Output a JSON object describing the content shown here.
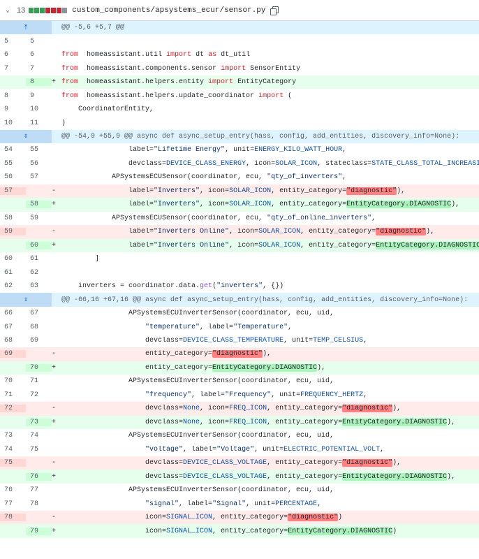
{
  "file": {
    "chevron": "⌄",
    "change_count": "13",
    "diffstat_colors": [
      "#2da44e",
      "#2da44e",
      "#2da44e",
      "#cf222e",
      "#cf222e",
      "#cf222e",
      "#8c959f"
    ],
    "path": "custom_components/apsystems_ecur/sensor.py",
    "copy_icon": "copy-icon"
  },
  "diff": [
    {
      "t": "hunk",
      "text": "@@ -5,6 +5,7 @@",
      "exp": "up"
    },
    {
      "t": "ctx",
      "o": "5",
      "n": "5",
      "segs": []
    },
    {
      "t": "ctx",
      "o": "6",
      "n": "6",
      "segs": [
        [
          "kw",
          "from"
        ],
        [
          "",
          "  homeassistant.util "
        ],
        [
          "kw",
          "import"
        ],
        [
          "",
          " dt "
        ],
        [
          "kw",
          "as"
        ],
        [
          "",
          " dt_util"
        ]
      ]
    },
    {
      "t": "ctx",
      "o": "7",
      "n": "7",
      "segs": [
        [
          "kw",
          "from"
        ],
        [
          "",
          "  homeassistant.components.sensor "
        ],
        [
          "kw",
          "import"
        ],
        [
          "",
          " SensorEntity"
        ]
      ]
    },
    {
      "t": "add",
      "o": "",
      "n": "8",
      "segs": [
        [
          "kw",
          "from"
        ],
        [
          "",
          "  homeassistant.helpers.entity "
        ],
        [
          "kw",
          "import"
        ],
        [
          "",
          " EntityCategory"
        ]
      ]
    },
    {
      "t": "ctx",
      "o": "8",
      "n": "9",
      "segs": [
        [
          "kw",
          "from"
        ],
        [
          "",
          "  homeassistant.helpers.update_coordinator "
        ],
        [
          "kw",
          "import"
        ],
        [
          "",
          " ("
        ]
      ]
    },
    {
      "t": "ctx",
      "o": "9",
      "n": "10",
      "segs": [
        [
          "",
          "    CoordinatorEntity,"
        ]
      ]
    },
    {
      "t": "ctx",
      "o": "10",
      "n": "11",
      "segs": [
        [
          "",
          ")"
        ]
      ]
    },
    {
      "t": "hunk",
      "text": "@@ -54,9 +55,9 @@ async def async_setup_entry(hass, config, add_entities, discovery_info=None):",
      "exp": "both"
    },
    {
      "t": "ctx",
      "o": "54",
      "n": "55",
      "segs": [
        [
          "",
          "                label="
        ],
        [
          "st",
          "\"Lifetime Energy\""
        ],
        [
          "",
          ", unit="
        ],
        [
          "cn",
          "ENERGY_KILO_WATT_HOUR"
        ],
        [
          "",
          ","
        ]
      ]
    },
    {
      "t": "ctx",
      "o": "55",
      "n": "56",
      "segs": [
        [
          "",
          "                devclass="
        ],
        [
          "cn",
          "DEVICE_CLASS_ENERGY"
        ],
        [
          "",
          ", icon="
        ],
        [
          "cn",
          "SOLAR_ICON"
        ],
        [
          "",
          ", stateclass="
        ],
        [
          "cn",
          "STATE_CLASS_TOTAL_INCREASING"
        ],
        [
          "",
          "),"
        ]
      ]
    },
    {
      "t": "ctx",
      "o": "56",
      "n": "57",
      "segs": [
        [
          "",
          "            APSystemsECUSensor(coordinator, ecu, "
        ],
        [
          "st",
          "\"qty_of_inverters\""
        ],
        [
          "",
          ","
        ]
      ]
    },
    {
      "t": "del",
      "o": "57",
      "n": "",
      "segs": [
        [
          "",
          "                label="
        ],
        [
          "st",
          "\"Inverters\""
        ],
        [
          "",
          ", icon="
        ],
        [
          "cn",
          "SOLAR_ICON"
        ],
        [
          "",
          ", entity_category="
        ],
        [
          "hl-del",
          "\"diagnostic\""
        ],
        [
          "",
          "),"
        ]
      ]
    },
    {
      "t": "add",
      "o": "",
      "n": "58",
      "segs": [
        [
          "",
          "                label="
        ],
        [
          "st",
          "\"Inverters\""
        ],
        [
          "",
          ", icon="
        ],
        [
          "cn",
          "SOLAR_ICON"
        ],
        [
          "",
          ", entity_category="
        ],
        [
          "hl-add",
          "EntityCategory.DIAGNOSTIC"
        ],
        [
          "",
          "),"
        ]
      ]
    },
    {
      "t": "ctx",
      "o": "58",
      "n": "59",
      "segs": [
        [
          "",
          "            APSystemsECUSensor(coordinator, ecu, "
        ],
        [
          "st",
          "\"qty_of_online_inverters\""
        ],
        [
          "",
          ","
        ]
      ]
    },
    {
      "t": "del",
      "o": "59",
      "n": "",
      "segs": [
        [
          "",
          "                label="
        ],
        [
          "st",
          "\"Inverters Online\""
        ],
        [
          "",
          ", icon="
        ],
        [
          "cn",
          "SOLAR_ICON"
        ],
        [
          "",
          ", entity_category="
        ],
        [
          "hl-del",
          "\"diagnostic\""
        ],
        [
          "",
          "),"
        ]
      ]
    },
    {
      "t": "add",
      "o": "",
      "n": "60",
      "segs": [
        [
          "",
          "                label="
        ],
        [
          "st",
          "\"Inverters Online\""
        ],
        [
          "",
          ", icon="
        ],
        [
          "cn",
          "SOLAR_ICON"
        ],
        [
          "",
          ", entity_category="
        ],
        [
          "hl-add",
          "EntityCategory.DIAGNOSTIC"
        ],
        [
          "",
          "),"
        ]
      ]
    },
    {
      "t": "ctx",
      "o": "60",
      "n": "61",
      "segs": [
        [
          "",
          "        ]"
        ]
      ]
    },
    {
      "t": "ctx",
      "o": "61",
      "n": "62",
      "segs": []
    },
    {
      "t": "ctx",
      "o": "62",
      "n": "63",
      "segs": [
        [
          "",
          "    inverters = coordinator.data."
        ],
        [
          "fn",
          "get"
        ],
        [
          "",
          "("
        ],
        [
          "st",
          "\"inverters\""
        ],
        [
          "",
          ", {})"
        ]
      ]
    },
    {
      "t": "hunk",
      "text": "@@ -66,16 +67,16 @@ async def async_setup_entry(hass, config, add_entities, discovery_info=None):",
      "exp": "both"
    },
    {
      "t": "ctx",
      "o": "66",
      "n": "67",
      "segs": [
        [
          "",
          "                APSystemsECUInverterSensor(coordinator, ecu, uid,"
        ]
      ]
    },
    {
      "t": "ctx",
      "o": "67",
      "n": "68",
      "segs": [
        [
          "",
          "                    "
        ],
        [
          "st",
          "\"temperature\""
        ],
        [
          "",
          ", label="
        ],
        [
          "st",
          "\"Temperature\""
        ],
        [
          "",
          ","
        ]
      ]
    },
    {
      "t": "ctx",
      "o": "68",
      "n": "69",
      "segs": [
        [
          "",
          "                    devclass="
        ],
        [
          "cn",
          "DEVICE_CLASS_TEMPERATURE"
        ],
        [
          "",
          ", unit="
        ],
        [
          "cn",
          "TEMP_CELSIUS"
        ],
        [
          "",
          ","
        ]
      ]
    },
    {
      "t": "del",
      "o": "69",
      "n": "",
      "segs": [
        [
          "",
          "                    entity_category="
        ],
        [
          "hl-del",
          "\"diagnostic\""
        ],
        [
          "",
          "),"
        ]
      ]
    },
    {
      "t": "add",
      "o": "",
      "n": "70",
      "segs": [
        [
          "",
          "                    entity_category="
        ],
        [
          "hl-add",
          "EntityCategory.DIAGNOSTIC"
        ],
        [
          "",
          "),"
        ]
      ]
    },
    {
      "t": "ctx",
      "o": "70",
      "n": "71",
      "segs": [
        [
          "",
          "                APSystemsECUInverterSensor(coordinator, ecu, uid,"
        ]
      ]
    },
    {
      "t": "ctx",
      "o": "71",
      "n": "72",
      "segs": [
        [
          "",
          "                    "
        ],
        [
          "st",
          "\"frequency\""
        ],
        [
          "",
          ", label="
        ],
        [
          "st",
          "\"Frequency\""
        ],
        [
          "",
          ", unit="
        ],
        [
          "cn",
          "FREQUENCY_HERTZ"
        ],
        [
          "",
          ","
        ]
      ]
    },
    {
      "t": "del",
      "o": "72",
      "n": "",
      "segs": [
        [
          "",
          "                    devclass="
        ],
        [
          "cn",
          "None"
        ],
        [
          "",
          ", icon="
        ],
        [
          "cn",
          "FREQ_ICON"
        ],
        [
          "",
          ", entity_category="
        ],
        [
          "hl-del",
          "\"diagnostic\""
        ],
        [
          "",
          "),"
        ]
      ]
    },
    {
      "t": "add",
      "o": "",
      "n": "73",
      "segs": [
        [
          "",
          "                    devclass="
        ],
        [
          "cn",
          "None"
        ],
        [
          "",
          ", icon="
        ],
        [
          "cn",
          "FREQ_ICON"
        ],
        [
          "",
          ", entity_category="
        ],
        [
          "hl-add",
          "EntityCategory.DIAGNOSTIC"
        ],
        [
          "",
          "),"
        ]
      ]
    },
    {
      "t": "ctx",
      "o": "73",
      "n": "74",
      "segs": [
        [
          "",
          "                APSystemsECUInverterSensor(coordinator, ecu, uid,"
        ]
      ]
    },
    {
      "t": "ctx",
      "o": "74",
      "n": "75",
      "segs": [
        [
          "",
          "                    "
        ],
        [
          "st",
          "\"voltage\""
        ],
        [
          "",
          ", label="
        ],
        [
          "st",
          "\"Voltage\""
        ],
        [
          "",
          ", unit="
        ],
        [
          "cn",
          "ELECTRIC_POTENTIAL_VOLT"
        ],
        [
          "",
          ","
        ]
      ]
    },
    {
      "t": "del",
      "o": "75",
      "n": "",
      "segs": [
        [
          "",
          "                    devclass="
        ],
        [
          "cn",
          "DEVICE_CLASS_VOLTAGE"
        ],
        [
          "",
          ", entity_category="
        ],
        [
          "hl-del",
          "\"diagnostic\""
        ],
        [
          "",
          "),"
        ]
      ]
    },
    {
      "t": "add",
      "o": "",
      "n": "76",
      "segs": [
        [
          "",
          "                    devclass="
        ],
        [
          "cn",
          "DEVICE_CLASS_VOLTAGE"
        ],
        [
          "",
          ", entity_category="
        ],
        [
          "hl-add",
          "EntityCategory.DIAGNOSTIC"
        ],
        [
          "",
          "),"
        ]
      ]
    },
    {
      "t": "ctx",
      "o": "76",
      "n": "77",
      "segs": [
        [
          "",
          "                APSystemsECUInverterSensor(coordinator, ecu, uid,"
        ]
      ]
    },
    {
      "t": "ctx",
      "o": "77",
      "n": "78",
      "segs": [
        [
          "",
          "                    "
        ],
        [
          "st",
          "\"signal\""
        ],
        [
          "",
          ", label="
        ],
        [
          "st",
          "\"Signal\""
        ],
        [
          "",
          ", unit="
        ],
        [
          "cn",
          "PERCENTAGE"
        ],
        [
          "",
          ","
        ]
      ]
    },
    {
      "t": "del",
      "o": "78",
      "n": "",
      "segs": [
        [
          "",
          "                    icon="
        ],
        [
          "cn",
          "SIGNAL_ICON"
        ],
        [
          "",
          ", entity_category="
        ],
        [
          "hl-del",
          "\"diagnostic\""
        ],
        [
          "",
          ")"
        ]
      ]
    },
    {
      "t": "add",
      "o": "",
      "n": "79",
      "segs": [
        [
          "",
          "                    icon="
        ],
        [
          "cn",
          "SIGNAL_ICON"
        ],
        [
          "",
          ", entity_category="
        ],
        [
          "hl-add",
          "EntityCategory.DIAGNOSTIC"
        ],
        [
          "",
          ")"
        ]
      ]
    }
  ]
}
